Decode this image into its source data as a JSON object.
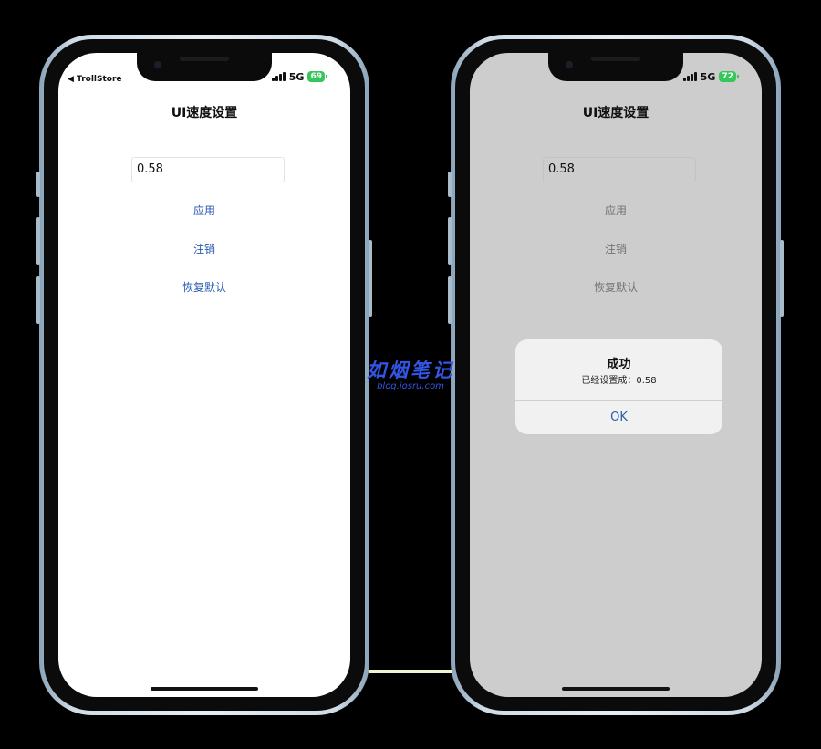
{
  "left_screen": {
    "back_label": "◀ TrollStore",
    "network": "5G",
    "battery": "69",
    "title": "UI速度设置",
    "speed_value": "0.58",
    "apply_label": "应用",
    "logout_label": "注销",
    "reset_label": "恢复默认"
  },
  "right_screen": {
    "network": "5G",
    "battery": "72",
    "title": "UI速度设置",
    "speed_value": "0.58",
    "apply_label": "应用",
    "logout_label": "注销",
    "reset_label": "恢复默认",
    "alert": {
      "title": "成功",
      "message": "已经设置成：0.58",
      "ok_label": "OK"
    }
  },
  "watermark": {
    "main": "如烟笔记",
    "sub": "blog.iosru.com"
  },
  "colors": {
    "link_blue": "#2a5ab0",
    "battery_green": "#34c759",
    "dim_overlay": "#cdcdcd",
    "watermark_blue": "#3256e4"
  }
}
